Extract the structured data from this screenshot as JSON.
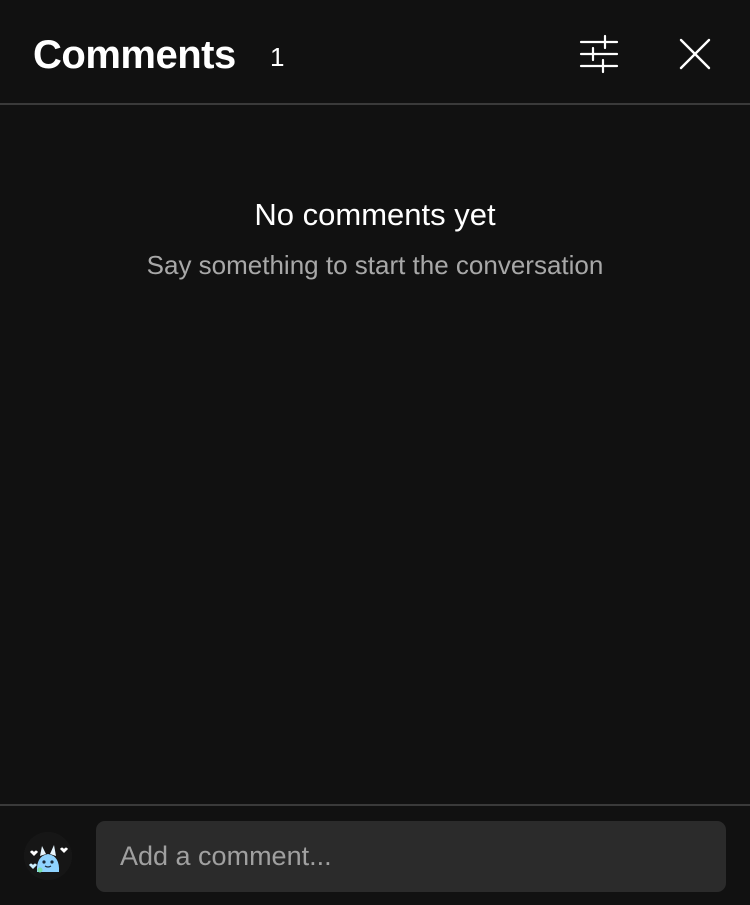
{
  "header": {
    "title": "Comments",
    "count": "1",
    "icons": {
      "filter": "sliders-icon",
      "close": "close-icon"
    }
  },
  "empty_state": {
    "title": "No comments yet",
    "subtitle": "Say something to start the conversation"
  },
  "composer": {
    "placeholder": "Add a comment...",
    "avatar_icon": "user-avatar"
  },
  "colors": {
    "background": "#111111",
    "divider": "#3a3a3a",
    "input_background": "#2b2b2b",
    "muted_text": "#a8a8a8",
    "avatar_accent": "#8fd3ff"
  }
}
